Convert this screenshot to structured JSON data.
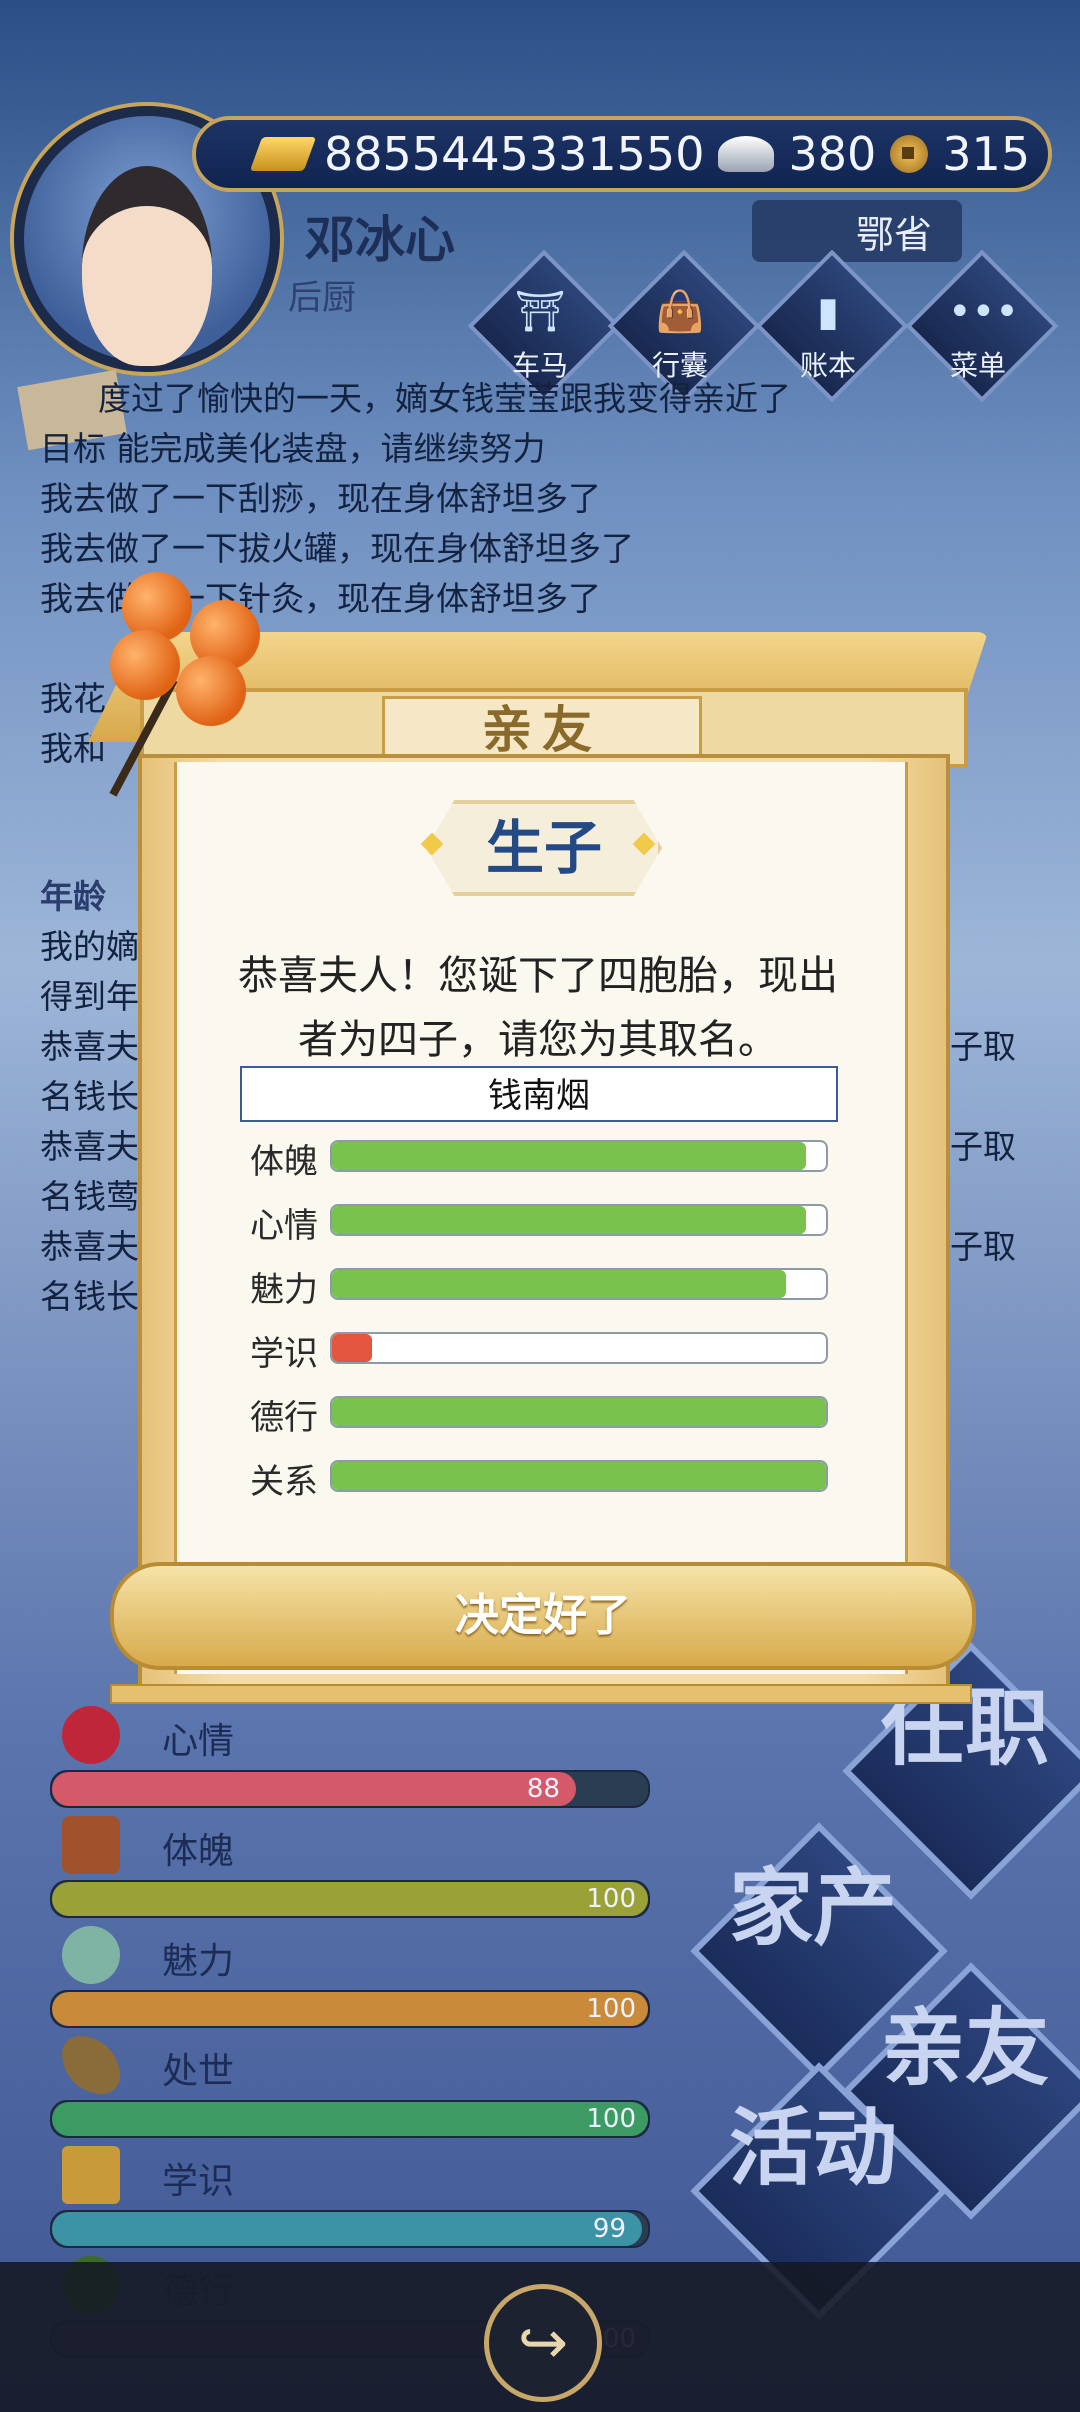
{
  "player": {
    "name": "邓冰心",
    "title": "后厨",
    "location": "鄂省"
  },
  "currency": {
    "gold": "8855445331550",
    "silver": "380",
    "coins": "315"
  },
  "nav": [
    {
      "label": "车马",
      "icon": "carriage-icon"
    },
    {
      "label": "行囊",
      "icon": "bag-icon"
    },
    {
      "label": "账本",
      "icon": "ledger-icon"
    },
    {
      "label": "菜单",
      "icon": "more-icon"
    }
  ],
  "log_lines": [
    "度过了愉快的一天，嫡女钱莹莹跟我变得亲近了",
    "目标 能完成美化装盘，请继续努力",
    "我去做了一下刮痧，现在身体舒坦多了",
    "我去做了一下拔火罐，现在身体舒坦多了",
    "我去做了一下针灸，现在身体舒坦多了",
    "我花",
    "我花",
    "我和",
    "年龄",
    "我的嫡",
    "得到年",
    "恭喜夫",
    "名钱长",
    "恭喜夫",
    "名钱莺",
    "恭喜夫",
    "名钱长"
  ],
  "log_right": [
    "子取",
    "子取",
    "子取"
  ],
  "stats": [
    {
      "label": "心情",
      "value": 88,
      "max": 100,
      "color": "#d45a6a",
      "icon": "flower-icon"
    },
    {
      "label": "体魄",
      "value": 100,
      "max": 100,
      "color": "#9aa136",
      "icon": "statue-icon"
    },
    {
      "label": "魅力",
      "value": 100,
      "max": 100,
      "color": "#c98a3a",
      "icon": "jade-icon"
    },
    {
      "label": "处世",
      "value": 100,
      "max": 100,
      "color": "#3c9a63",
      "icon": "fan-icon"
    },
    {
      "label": "学识",
      "value": 99,
      "max": 100,
      "color": "#3d93a6",
      "icon": "books-icon"
    },
    {
      "label": "德行",
      "value": 100,
      "max": 100,
      "color": "#5a3a7a",
      "icon": "medal-icon"
    }
  ],
  "right_buttons": [
    "任职",
    "家产",
    "亲友",
    "活动"
  ],
  "dialog": {
    "tab_title": "亲友",
    "heading": "生子",
    "message_line1": "恭喜夫人！您诞下了四胞胎，现出",
    "message_line2": "者为四子，请您为其取名。",
    "child_name": "钱南烟",
    "confirm_label": "决定好了",
    "attributes": [
      {
        "label": "体魄",
        "value": 0.96,
        "color": "#78c24e"
      },
      {
        "label": "心情",
        "value": 0.96,
        "color": "#78c24e"
      },
      {
        "label": "魅力",
        "value": 0.92,
        "color": "#78c24e"
      },
      {
        "label": "学识",
        "value": 0.08,
        "color": "#e2553f"
      },
      {
        "label": "德行",
        "value": 1.0,
        "color": "#78c24e"
      },
      {
        "label": "关系",
        "value": 1.0,
        "color": "#78c24e"
      }
    ]
  }
}
